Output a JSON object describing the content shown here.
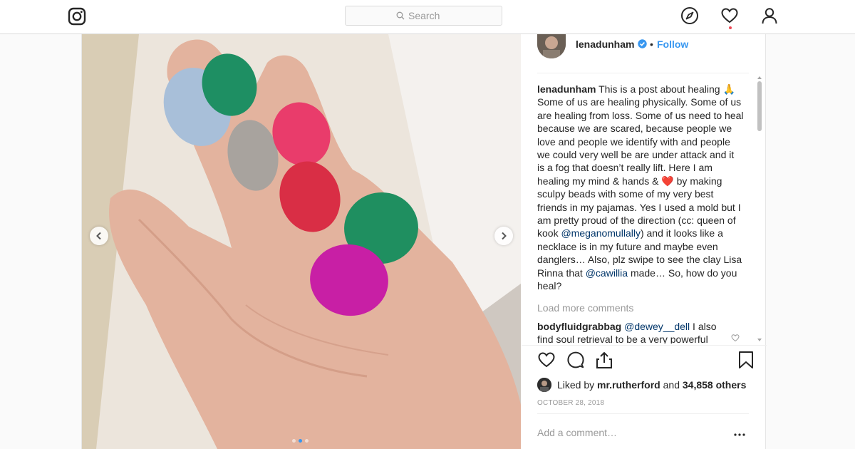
{
  "nav": {
    "search_placeholder": "Search",
    "icons": [
      "instagram-icon",
      "search-icon",
      "compass-icon",
      "heart-icon",
      "profile-icon"
    ],
    "notification_color": "#ed4956"
  },
  "post": {
    "username": "lenadunham",
    "separator": "•",
    "follow_label": "Follow",
    "caption_user": "lenadunham",
    "caption_1": "This is a post about healing 🙏 Some of us are healing physically. Some of us are healing from loss. Some of us need to heal because we are scared, because people we love and people we identify with and people we could very well be are under attack and it is a fog that doesn’t really lift. Here I am healing my mind & hands & ❤️ by making sculpy beads with some of my very best friends in my pajamas. Yes I used a mold but I am pretty proud of the direction (cc: queen of kook ",
    "mention_1": "@meganomullally",
    "caption_2": ") and it looks like a necklace is in my future and maybe even danglers… Also, plz swipe to see the clay Lisa Rinna that ",
    "mention_2": "@cawillia",
    "caption_3": " made… So, how do you heal?",
    "load_more": "Load more comments",
    "comment": {
      "user": "bodyfluidgrabbag",
      "mention": "@dewey__dell",
      "text": " I also find soul retrieval to be a very powerful"
    },
    "liked_by_prefix": "Liked by ",
    "liked_by_user": "mr.rutherford",
    "liked_by_and": " and ",
    "likes_count": "34,858 others",
    "date": "OCTOBER 28, 2018",
    "add_comment_placeholder": "Add a comment…",
    "carousel": {
      "slides": 3,
      "active": 2
    },
    "accent_color": "#3897f0"
  }
}
